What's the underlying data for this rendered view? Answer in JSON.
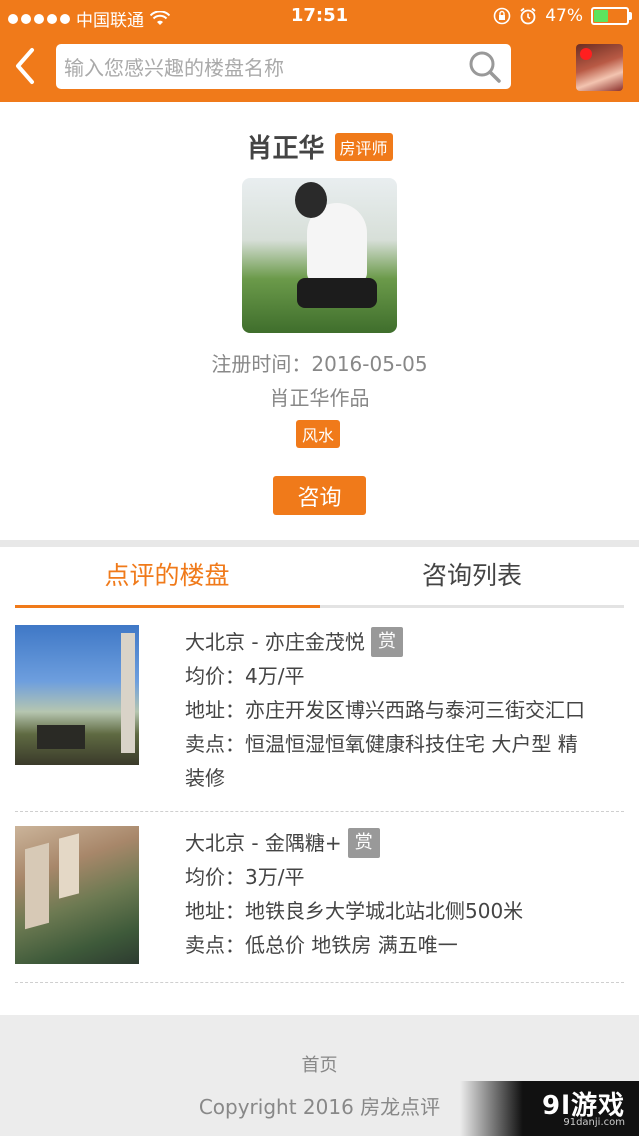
{
  "status_bar": {
    "carrier": "中国联通",
    "time": "17:51",
    "battery": "47%"
  },
  "header": {
    "search_placeholder": "输入您感兴趣的楼盘名称",
    "icons": {
      "back": "back-arrow-icon",
      "search": "search-icon"
    }
  },
  "profile": {
    "name": "肖正华",
    "role": "房评师",
    "register_label": "注册时间：",
    "register_date": "2016-05-05",
    "works": "肖正华作品",
    "tag": "风水",
    "consult_button": "咨询"
  },
  "tabs": [
    {
      "label": "点评的楼盘",
      "active": true
    },
    {
      "label": "咨询列表",
      "active": false
    }
  ],
  "listings": [
    {
      "title": "大北京 - 亦庄金茂悦",
      "reward": "赏",
      "price_label": "均价：",
      "price": "4万/平",
      "address_label": "地址：",
      "address": "亦庄开发区博兴西路与泰河三街交汇口",
      "selling_label": "卖点：",
      "selling_points_line1": "恒温恒湿恒氧健康科技住宅 大户型 精",
      "selling_points_line2": "装修"
    },
    {
      "title": "大北京 - 金隅糖+",
      "reward": "赏",
      "price_label": "均价：",
      "price": "3万/平",
      "address_label": "地址：",
      "address": "地铁良乡大学城北站北侧500米",
      "selling_label": "卖点：",
      "selling_points_line1": "低总价 地铁房 满五唯一"
    }
  ],
  "footer": {
    "home": "首页",
    "copyright": "Copyright 2016 房龙点评"
  },
  "watermark": {
    "logo": "9l游戏",
    "url": "91danji.com"
  },
  "colors": {
    "accent": "#f07a1a",
    "reward_badge": "#999999"
  }
}
